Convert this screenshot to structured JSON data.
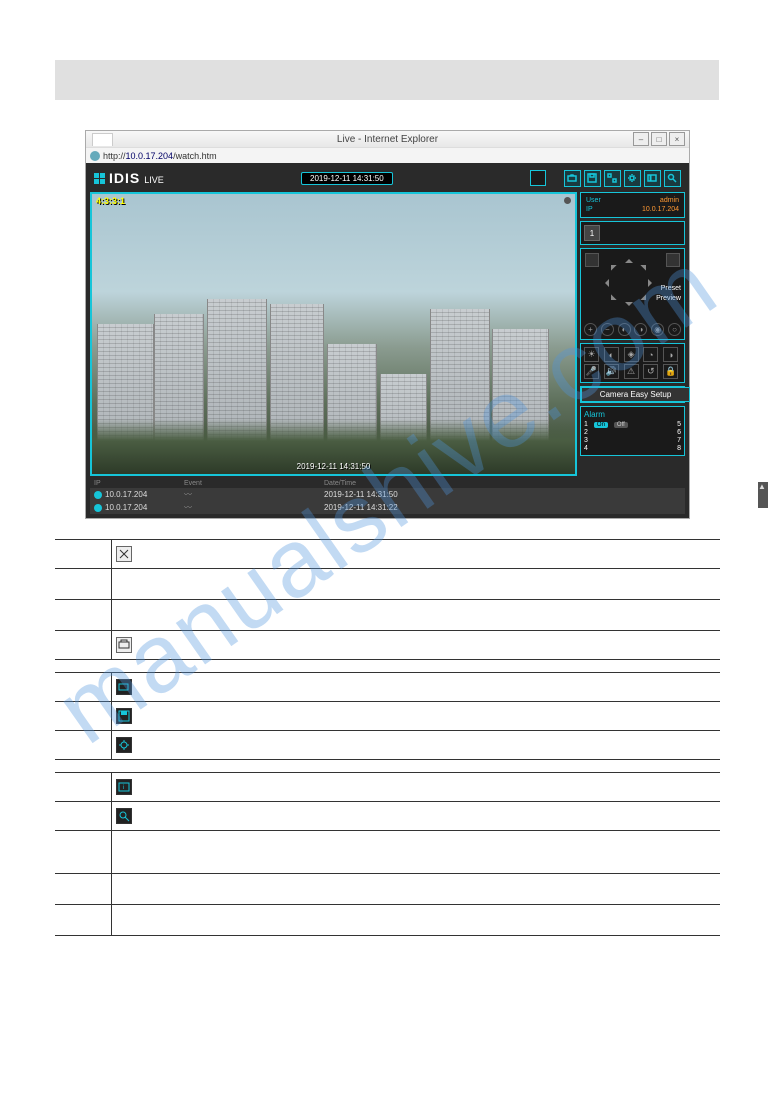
{
  "window": {
    "title": "Live - Internet Explorer",
    "url_prefix": "http://",
    "url_host": "10.0.17.204",
    "url_path": "/watch.htm"
  },
  "app": {
    "brand": "IDIS",
    "mode": "LIVE",
    "timestamp": "2019-12-11 14:31:50"
  },
  "camera": {
    "label": "4:3:3:1",
    "osd_time": "2019-12-11 14:31:50"
  },
  "user_panel": {
    "user_label": "User",
    "user_value": "admin",
    "ip_label": "IP",
    "ip_value": "10.0.17.204"
  },
  "camera_select": {
    "active": "1"
  },
  "ptz": {
    "preset": "Preset",
    "preview": "Preview",
    "zoom_in": "+",
    "zoom_out": "−"
  },
  "easy_setup": "Camera Easy Setup",
  "alarm": {
    "title": "Alarm",
    "on": "On",
    "off": "Off",
    "items": [
      "1",
      "2",
      "3",
      "4",
      "5",
      "6",
      "7",
      "8"
    ]
  },
  "events": {
    "cols": [
      "IP",
      "Event",
      "Date/Time"
    ],
    "rows": [
      {
        "ip": "10.0.17.204",
        "time": "2019-12-11 14:31:50"
      },
      {
        "ip": "10.0.17.204",
        "time": "2019-12-11 14:31:22"
      }
    ]
  },
  "watermark": "manualshive.com",
  "icons": {
    "print": "print-icon",
    "camera": "camera-icon",
    "save": "save-icon",
    "draw": "draw-icon",
    "setup": "setup-icon",
    "about": "about-icon",
    "search": "search-icon"
  }
}
